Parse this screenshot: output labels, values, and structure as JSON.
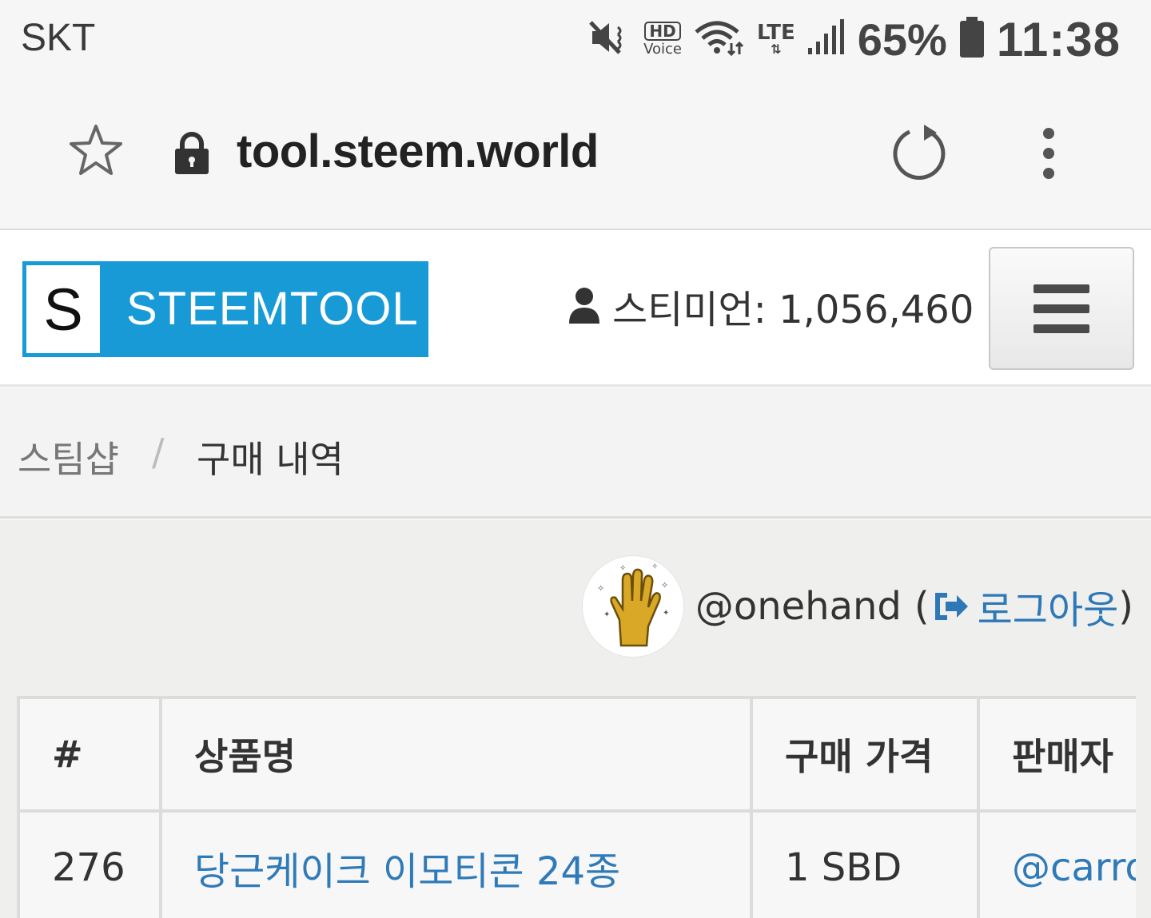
{
  "status_bar": {
    "carrier": "SKT",
    "hd_label": "HD",
    "voice_label": "Voice",
    "lte_label": "LTE",
    "battery_percent": "65%",
    "time": "11:38",
    "icons": [
      "mute-vibrate-icon",
      "hd-voice-icon",
      "wifi-icon",
      "lte-icon",
      "signal-icon",
      "battery-icon"
    ]
  },
  "browser": {
    "url": "tool.steem.world",
    "icons": [
      "star-icon",
      "lock-icon",
      "reload-icon",
      "more-vert-icon"
    ]
  },
  "header": {
    "logo_letter": "S",
    "logo_text": "STEEMTOOL",
    "logo_color": "#179ad6",
    "steemian_label": "스티미언: 1,056,460"
  },
  "breadcrumb": {
    "items": [
      "스팀샵",
      "구매 내역"
    ],
    "separator": "/"
  },
  "user": {
    "handle": "@onehand",
    "open_paren": "(",
    "logout_label": "로그아웃",
    "close_paren": ")",
    "link_color": "#2e78b8"
  },
  "table": {
    "headers": [
      "#",
      "상품명",
      "구매 가격",
      "판매자"
    ],
    "rows": [
      [
        "276",
        "당근케이크 이모티콘 24종",
        "1 SBD",
        "@carro"
      ]
    ]
  }
}
